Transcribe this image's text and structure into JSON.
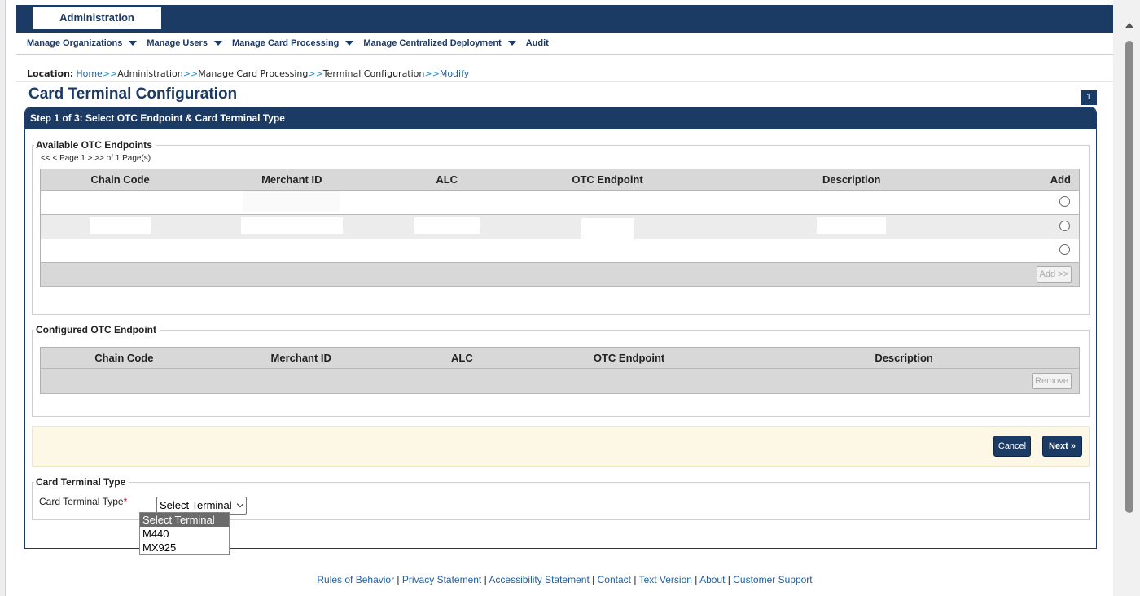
{
  "header": {
    "tab": "Administration"
  },
  "menu": [
    {
      "label": "Manage Organizations",
      "has_caret": true
    },
    {
      "label": "Manage Users",
      "has_caret": true
    },
    {
      "label": "Manage Card Processing",
      "has_caret": true
    },
    {
      "label": "Manage Centralized Deployment",
      "has_caret": true
    },
    {
      "label": "Audit",
      "has_caret": false
    }
  ],
  "location": {
    "label": "Location:",
    "crumbs": [
      "Home",
      "Administration",
      "Manage Card Processing",
      "Terminal Configuration",
      "Modify"
    ],
    "separator": ">>"
  },
  "page": {
    "title": "Card Terminal Configuration",
    "badge": "1"
  },
  "panel": {
    "heading": "Step 1 of 3: Select OTC Endpoint & Card Terminal Type"
  },
  "available": {
    "legend": "Available OTC Endpoints",
    "pager": "<< < Page 1 > >> of 1 Page(s)",
    "columns": [
      "Chain Code",
      "Merchant ID",
      "ALC",
      "OTC Endpoint",
      "Description",
      "Add"
    ],
    "add_button": "Add >>"
  },
  "configured": {
    "legend": "Configured OTC Endpoint",
    "columns": [
      "Chain Code",
      "Merchant ID",
      "ALC",
      "OTC Endpoint",
      "Description"
    ],
    "remove_button": "Remove"
  },
  "actions": {
    "cancel": "Cancel",
    "next": "Next »"
  },
  "terminal": {
    "legend": "Card Terminal Type",
    "label": "Card Terminal Type",
    "required_mark": "*",
    "selected": "Select Terminal",
    "options": [
      "Select Terminal",
      "M440",
      "MX925"
    ]
  },
  "footer": {
    "links": [
      "Rules of Behavior",
      "Privacy Statement",
      "Accessibility Statement",
      "Contact",
      "Text Version",
      "About",
      "Customer Support"
    ],
    "separator": "|"
  },
  "colors": {
    "brand_navy": "#1b3a64",
    "link_blue": "#1f5fa6",
    "action_bar_bg": "#fdf8e6"
  }
}
